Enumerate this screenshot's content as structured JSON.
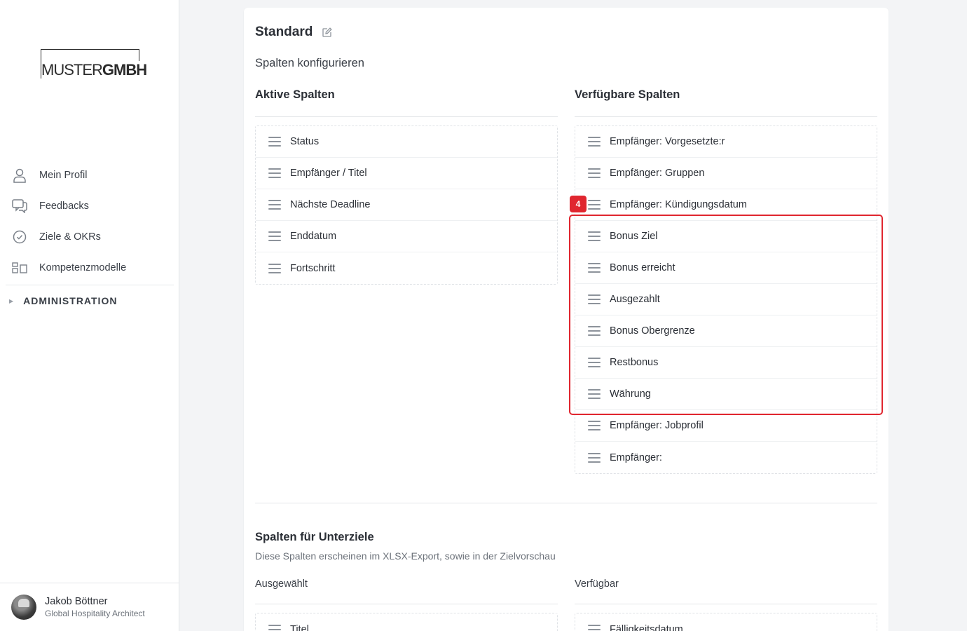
{
  "logo": {
    "light": "MUSTER",
    "bold": "GMBH"
  },
  "nav": {
    "items": [
      {
        "label": "Mein Profil",
        "icon": "user-icon"
      },
      {
        "label": "Feedbacks",
        "icon": "chat-icon"
      },
      {
        "label": "Ziele & OKRs",
        "icon": "check-circle-icon"
      },
      {
        "label": "Kompetenzmodelle",
        "icon": "grid-icon"
      }
    ],
    "admin_label": "ADMINISTRATION"
  },
  "user": {
    "name": "Jakob Böttner",
    "role": "Global Hospitality Architect"
  },
  "card": {
    "title": "Standard",
    "section_title": "Spalten konfigurieren",
    "active_heading": "Aktive Spalten",
    "available_heading": "Verfügbare Spalten",
    "active_columns": [
      "Status",
      "Empfänger / Titel",
      "Nächste Deadline",
      "Enddatum",
      "Fortschritt"
    ],
    "available_columns": [
      "Empfänger: Vorgesetzte:r",
      "Empfänger: Gruppen",
      "Empfänger: Kündigungsdatum",
      "Bonus Ziel",
      "Bonus erreicht",
      "Ausgezahlt",
      "Bonus Obergrenze",
      "Restbonus",
      "Währung",
      "Empfänger: Jobprofil",
      "Empfänger:"
    ],
    "sub": {
      "title": "Spalten für Unterziele",
      "description": "Diese Spalten erscheinen im XLSX-Export, sowie in der Zielvorschau",
      "selected_heading": "Ausgewählt",
      "available_heading": "Verfügbar",
      "selected_columns": [
        "Titel"
      ],
      "available_columns": [
        "Fälligkeitsdatum"
      ]
    }
  },
  "annotation": {
    "badge": "4",
    "color": "#e0262f"
  }
}
